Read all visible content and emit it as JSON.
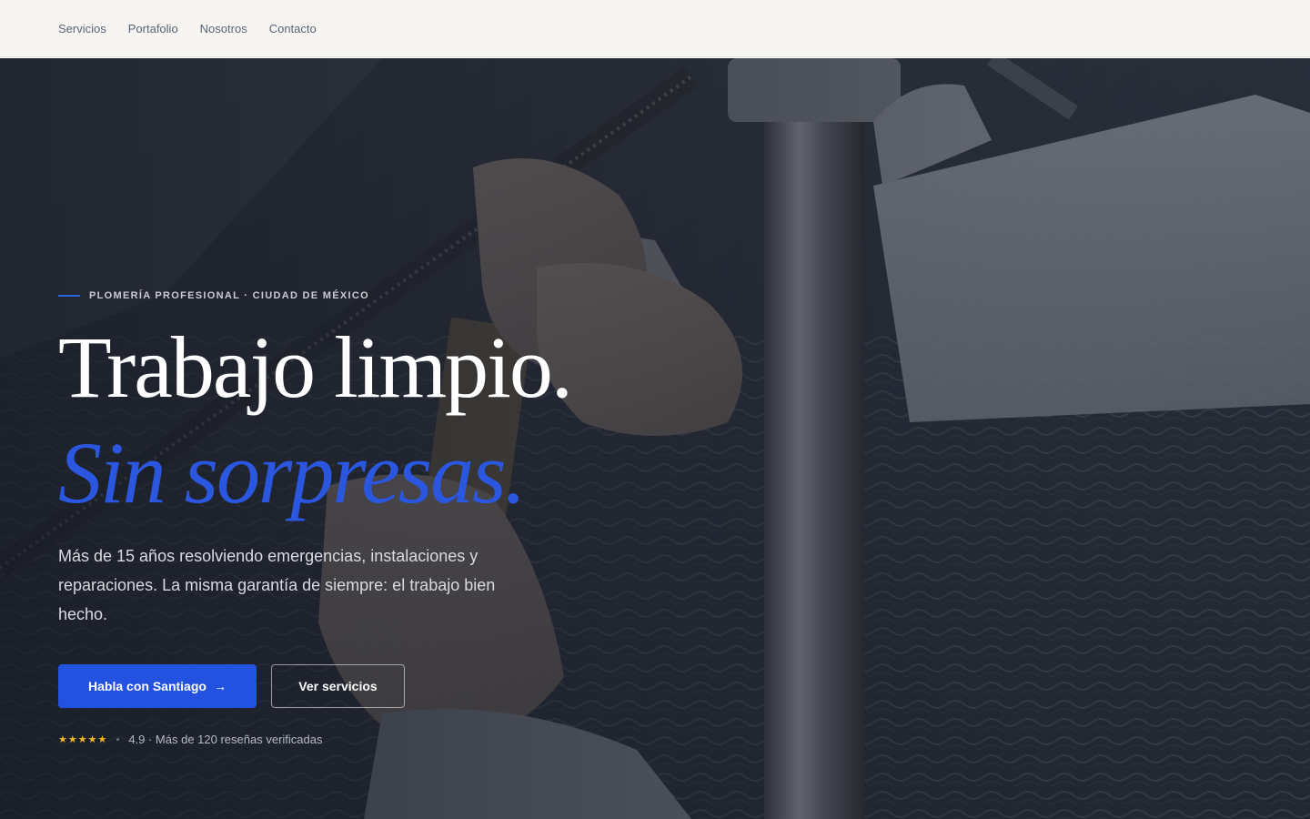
{
  "nav": {
    "items": [
      {
        "label": "Servicios"
      },
      {
        "label": "Portafolio"
      },
      {
        "label": "Nosotros"
      },
      {
        "label": "Contacto"
      }
    ]
  },
  "hero": {
    "eyebrow": "PLOMERÍA PROFESIONAL · CIUDAD DE MÉXICO",
    "headline_line1": "Trabajo limpio.",
    "headline_line2": "Sin sorpresas.",
    "lede": "Más de 15 años resolviendo emergencias, instalaciones y reparaciones. La misma garantía de siempre: el trabajo bien hecho.",
    "primary_cta": "Habla con Santiago",
    "primary_cta_arrow": "→",
    "secondary_cta": "Ver servicios",
    "rating_stars": "★★★★★",
    "rating_text": "4.9 · Más de 120 reseñas verificadas",
    "background_icon": "plumber-hands-pipes-photo"
  },
  "colors": {
    "accent": "#2452e0",
    "headline_italic": "#2b57e0",
    "nav_bg": "#f6f5f1",
    "stars": "#f2b822"
  }
}
